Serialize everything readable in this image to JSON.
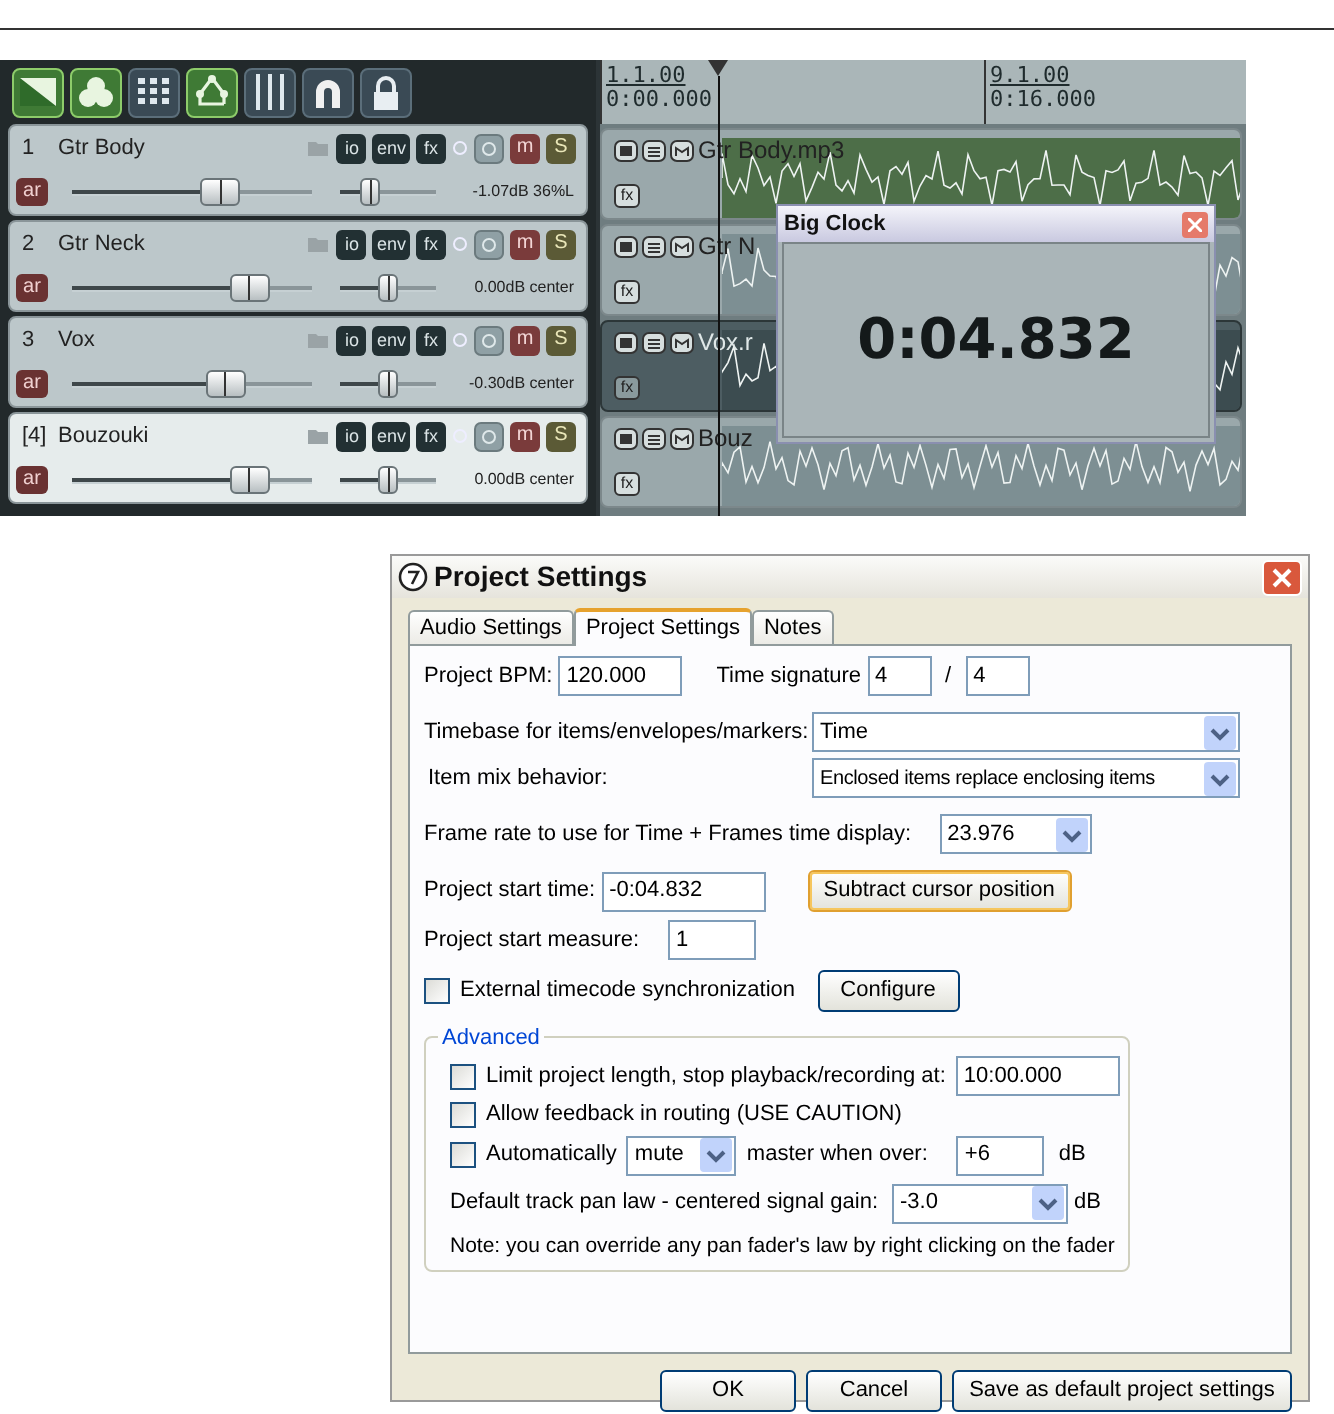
{
  "toolbar": {
    "buttons": [
      {
        "kind": "envelope",
        "on": true
      },
      {
        "kind": "clover",
        "on": true
      },
      {
        "kind": "grid",
        "on": false
      },
      {
        "kind": "routing",
        "on": true
      },
      {
        "kind": "bars",
        "on": false
      },
      {
        "kind": "magnet",
        "on": false
      },
      {
        "kind": "lock",
        "on": false
      }
    ]
  },
  "tracks": [
    {
      "number": "1",
      "name": "Gtr Body",
      "selected": false,
      "volume": {
        "level": 0.62
      },
      "pan": {
        "level": 0.32
      },
      "reading": "-1.07dB 36%L",
      "arm_label": "ar",
      "buttons": [
        "io",
        "env",
        "fx",
        "m",
        "S"
      ]
    },
    {
      "number": "2",
      "name": "Gtr Neck",
      "selected": false,
      "volume": {
        "level": 0.74
      },
      "pan": {
        "level": 0.5
      },
      "reading": "0.00dB center",
      "arm_label": "ar",
      "buttons": [
        "io",
        "env",
        "fx",
        "m",
        "S"
      ]
    },
    {
      "number": "3",
      "name": "Vox",
      "selected": false,
      "volume": {
        "level": 0.64
      },
      "pan": {
        "level": 0.5
      },
      "reading": "-0.30dB center",
      "arm_label": "ar",
      "buttons": [
        "io",
        "env",
        "fx",
        "m",
        "S"
      ]
    },
    {
      "number": "[4]",
      "name": "Bouzouki",
      "selected": true,
      "volume": {
        "level": 0.74
      },
      "pan": {
        "level": 0.5
      },
      "reading": "0.00dB center",
      "arm_label": "ar",
      "buttons": [
        "io",
        "env",
        "fx",
        "m",
        "S"
      ]
    }
  ],
  "ruler": {
    "markers": [
      {
        "measure": "1.1.00",
        "time": "0:00.000"
      },
      {
        "measure": "9.1.00",
        "time": "0:16.000"
      }
    ]
  },
  "items": [
    {
      "name": "Gtr Body.mp3",
      "selected": false,
      "fx_label": "fx"
    },
    {
      "name": "Gtr N",
      "selected": false,
      "fx_label": "fx"
    },
    {
      "name": "Vox.r",
      "selected": true,
      "fx_label": "fx"
    },
    {
      "name": "Bouz",
      "selected": false,
      "fx_label": "fx"
    }
  ],
  "big_clock": {
    "title": "Big Clock",
    "time": "0:04.832"
  },
  "dialog": {
    "title": "Project Settings",
    "tabs": [
      {
        "label": "Audio Settings",
        "selected": false
      },
      {
        "label": "Project Settings",
        "selected": true
      },
      {
        "label": "Notes",
        "selected": false
      }
    ],
    "bpm": {
      "label": "Project BPM:",
      "value": "120.000"
    },
    "time_signature": {
      "label": "Time signature",
      "numerator": "4",
      "separator": "/",
      "denominator": "4"
    },
    "timebase": {
      "label": "Timebase for items/envelopes/markers:",
      "value": "Time"
    },
    "item_mix": {
      "label": "Item mix behavior:",
      "value": "Enclosed items replace enclosing items"
    },
    "frame_rate": {
      "label": "Frame rate to use for Time + Frames time display:",
      "value": "23.976"
    },
    "start_time": {
      "label": "Project start time:",
      "value": "-0:04.832",
      "button": "Subtract cursor position"
    },
    "start_measure": {
      "label": "Project start measure:",
      "value": "1"
    },
    "timecode_sync": {
      "label": "External timecode synchronization",
      "checked": false,
      "button": "Configure"
    },
    "advanced": {
      "legend": "Advanced",
      "limit": {
        "label": "Limit project length, stop playback/recording at:",
        "checked": false,
        "value": "10:00.000"
      },
      "feedback": {
        "label": "Allow feedback in routing (USE CAUTION)",
        "checked": false
      },
      "auto": {
        "label": "Automatically",
        "checked": false,
        "action": "mute",
        "middle": "master when over:",
        "value": "+6",
        "unit": "dB"
      },
      "pan_law": {
        "label": "Default track pan law - centered signal gain:",
        "value": "-3.0",
        "unit": "dB"
      },
      "note": "Note: you can override any pan fader's law by right clicking on the fader"
    },
    "buttons": [
      "OK",
      "Cancel",
      "Save as default project settings"
    ]
  }
}
